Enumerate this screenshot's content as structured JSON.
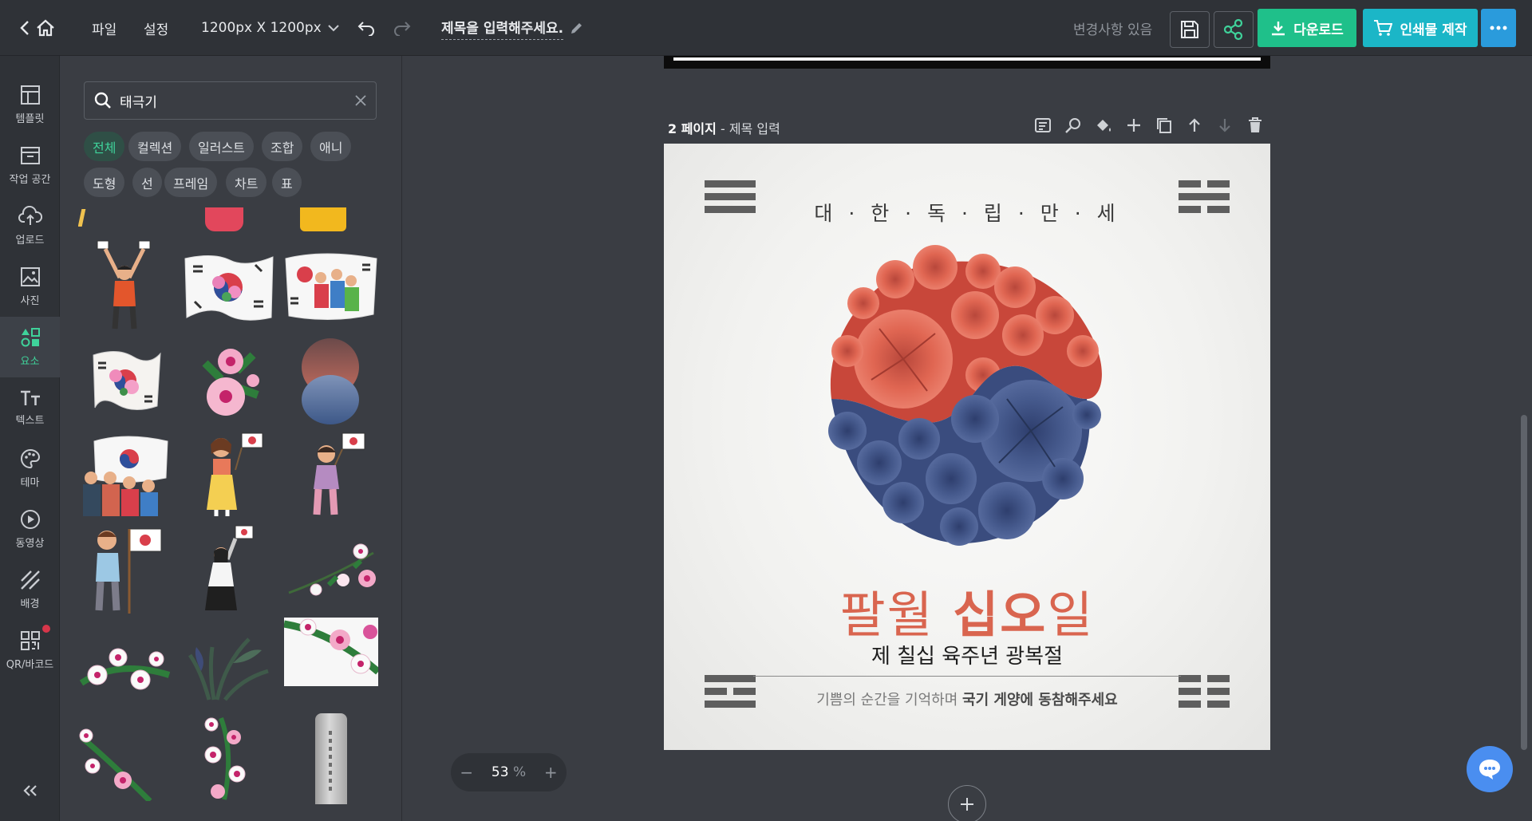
{
  "topbar": {
    "file_label": "파일",
    "settings_label": "설정",
    "size_label": "1200px X 1200px",
    "title_placeholder": "제목을 입력해주세요.",
    "changes_label": "변경사항 있음",
    "download_label": "다운로드",
    "print_label": "인쇄물 제작",
    "colors": {
      "download": "#1fc08a",
      "print": "#1bb6c7",
      "more": "#2a9bdc"
    }
  },
  "rail": {
    "items": [
      {
        "label": "템플릿",
        "icon": "template-icon"
      },
      {
        "label": "작업 공간",
        "icon": "workspace-icon"
      },
      {
        "label": "업로드",
        "icon": "upload-icon"
      },
      {
        "label": "사진",
        "icon": "photo-icon"
      },
      {
        "label": "요소",
        "icon": "elements-icon",
        "active": true
      },
      {
        "label": "텍스트",
        "icon": "text-icon"
      },
      {
        "label": "테마",
        "icon": "theme-icon"
      },
      {
        "label": "동영상",
        "icon": "video-icon"
      },
      {
        "label": "배경",
        "icon": "background-icon"
      },
      {
        "label": "QR/바코드",
        "icon": "qr-icon",
        "badge": true
      }
    ]
  },
  "panel": {
    "search_value": "태극기",
    "chips": [
      "전체",
      "컬렉션",
      "일러스트",
      "조합",
      "애니",
      "도형",
      "선",
      "프레임",
      "차트",
      "표"
    ],
    "active_chip": "전체"
  },
  "canvas": {
    "page_number": "2 페이지",
    "page_title": "- 제목 입력",
    "design": {
      "top_text": "대 · 한 · 독 · 립 · 만 · 세",
      "title_a": "팔월",
      "title_b": "십오",
      "title_c": "일",
      "subtitle": "제 칠십 육주년 광복절",
      "footer_normal": "기쁨의 순간을 기억하며",
      "footer_bold": "국기 게양에 동참해주세요"
    },
    "zoom": "53",
    "zoom_unit": "%"
  }
}
